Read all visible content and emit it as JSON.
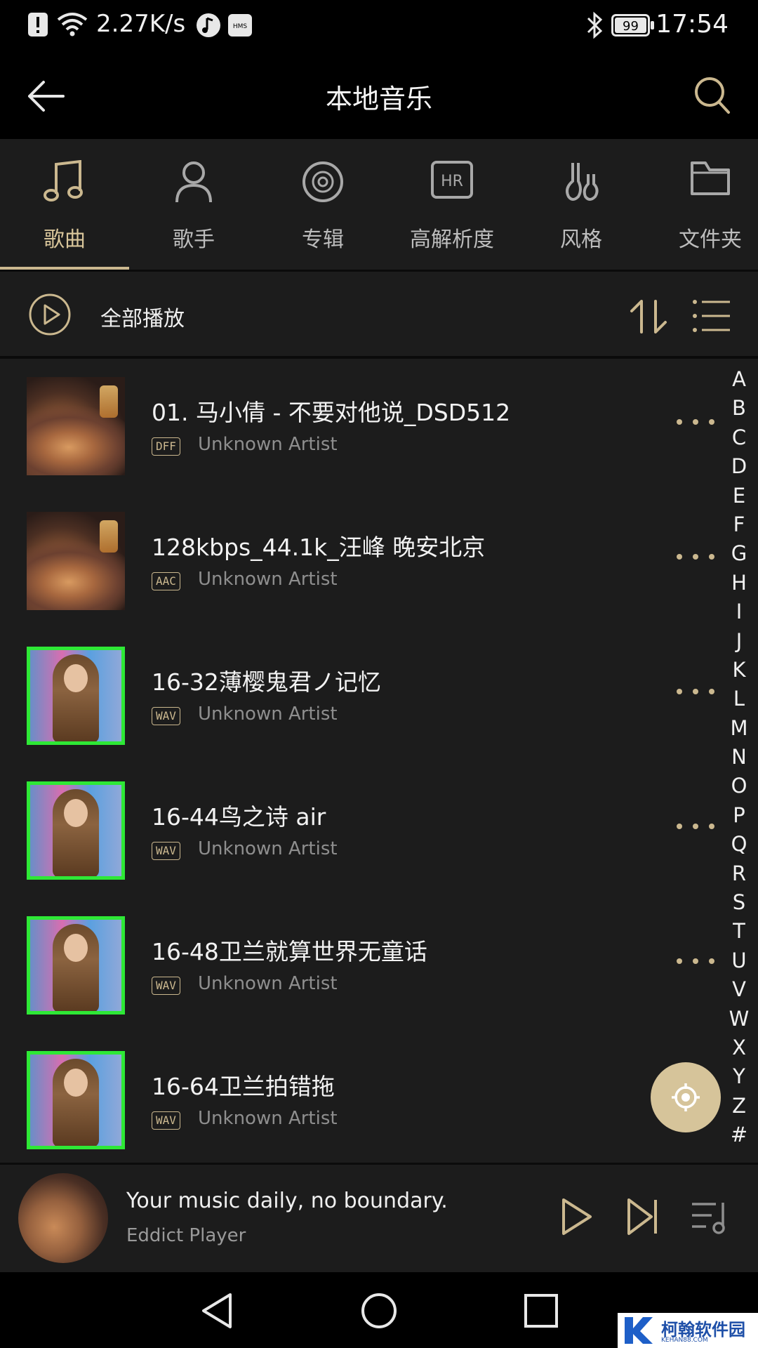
{
  "status_bar": {
    "network_speed": "2.27K/s",
    "battery": "99",
    "time": "17:54",
    "icons": [
      "alert-icon",
      "wifi-icon",
      "music-app-icon",
      "hms-icon",
      "bluetooth-icon",
      "battery-icon"
    ]
  },
  "header": {
    "title": "本地音乐"
  },
  "categories": [
    {
      "label": "歌曲",
      "icon": "music-note-icon",
      "active": true
    },
    {
      "label": "歌手",
      "icon": "person-icon",
      "active": false
    },
    {
      "label": "专辑",
      "icon": "disc-icon",
      "active": false
    },
    {
      "label": "高解析度",
      "icon": "hr-icon",
      "active": false
    },
    {
      "label": "风格",
      "icon": "guitar-icon",
      "active": false
    },
    {
      "label": "文件夹",
      "icon": "folder-icon",
      "active": false
    }
  ],
  "play_all": {
    "label": "全部播放"
  },
  "songs": [
    {
      "title": "01. 马小倩 - 不要对他说_DSD512",
      "format": "DFF",
      "artist": "Unknown Artist",
      "art": "vinyl"
    },
    {
      "title": "128kbps_44.1k_汪峰 晚安北京",
      "format": "AAC",
      "artist": "Unknown Artist",
      "art": "vinyl"
    },
    {
      "title": "16-32薄樱鬼君ノ记忆",
      "format": "WAV",
      "artist": "Unknown Artist",
      "art": "photo"
    },
    {
      "title": "16-44鸟之诗 air",
      "format": "WAV",
      "artist": "Unknown Artist",
      "art": "photo"
    },
    {
      "title": "16-48卫兰就算世界无童话",
      "format": "WAV",
      "artist": "Unknown Artist",
      "art": "photo"
    },
    {
      "title": "16-64卫兰拍错拖",
      "format": "WAV",
      "artist": "Unknown Artist",
      "art": "photo"
    }
  ],
  "index_letters": [
    "A",
    "B",
    "C",
    "D",
    "E",
    "F",
    "G",
    "H",
    "I",
    "J",
    "K",
    "L",
    "M",
    "N",
    "O",
    "P",
    "Q",
    "R",
    "S",
    "T",
    "U",
    "V",
    "W",
    "X",
    "Y",
    "Z",
    "#"
  ],
  "mini_player": {
    "song": "Your music daily, no boundary.",
    "app": "Eddict Player"
  },
  "watermark": {
    "text": "柯翰软件园",
    "sub": "KEHAN88.COM"
  },
  "colors": {
    "accent": "#cbb88f",
    "background": "#1c1c1c",
    "bar": "#000000"
  }
}
